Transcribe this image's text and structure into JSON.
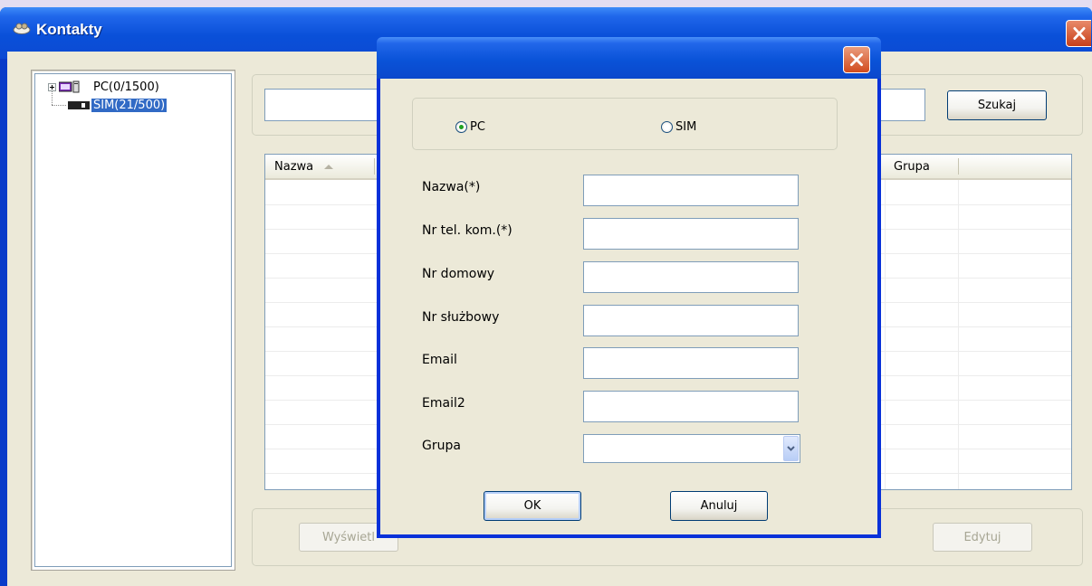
{
  "window": {
    "title": "Kontakty"
  },
  "tree": {
    "items": [
      {
        "label": "PC(0/1500)",
        "selected": false
      },
      {
        "label": "SIM(21/500)",
        "selected": true
      }
    ]
  },
  "toolbar": {
    "search_value": "",
    "search_button_label": "Szukaj"
  },
  "contacts_list": {
    "columns": [
      "Nazwa",
      "Grupa"
    ],
    "rows": []
  },
  "bottom_buttons": {
    "view_label": "Wyświetl",
    "edit_label": "Edytuj"
  },
  "dialog": {
    "title": "",
    "storage_options": [
      {
        "label": "PC",
        "selected": true
      },
      {
        "label": "SIM",
        "selected": false
      }
    ],
    "fields": [
      {
        "label": "Nazwa(*)",
        "value": ""
      },
      {
        "label": "Nr tel. kom.(*)",
        "value": ""
      },
      {
        "label": "Nr domowy",
        "value": ""
      },
      {
        "label": "Nr służbowy",
        "value": ""
      },
      {
        "label": "Email",
        "value": ""
      },
      {
        "label": "Email2",
        "value": ""
      }
    ],
    "group_label": "Grupa",
    "group_value": "",
    "ok_label": "OK",
    "cancel_label": "Anuluj"
  },
  "icons": {
    "title": "contacts-icon",
    "close": "close-icon",
    "pc": "computer-icon",
    "sim": "sim-card-icon",
    "expand": "plus-icon",
    "sort": "sort-ascending-icon",
    "dropdown": "chevron-down-icon"
  },
  "colors": {
    "titlebar": "#0a50d9",
    "client": "#ece9d8",
    "selection": "#316ac5",
    "close_button": "#c8401a"
  }
}
